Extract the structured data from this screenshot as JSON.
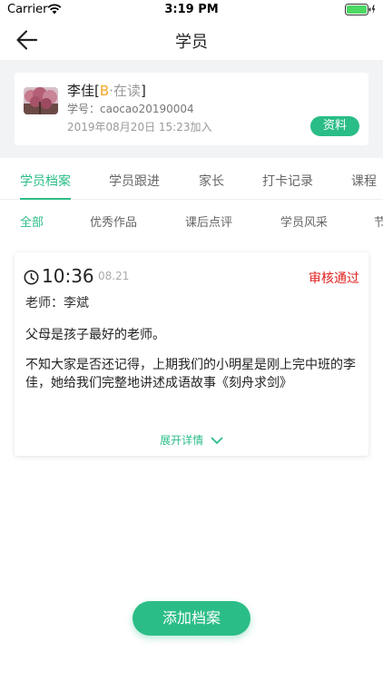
{
  "status_bar": {
    "carrier": "Carrier",
    "time": "3:19 PM"
  },
  "nav": {
    "title": "学员"
  },
  "student": {
    "name": "李佳",
    "bracket_open": "[",
    "level": "B",
    "status": "·在读",
    "bracket_close": "]",
    "id_line": "学号：caocao20190004",
    "join_date": "2019年08月20日 15:23加入",
    "profile_button": "资料"
  },
  "main_tabs": [
    {
      "label": "学员档案",
      "active": true
    },
    {
      "label": "学员跟进"
    },
    {
      "label": "家长"
    },
    {
      "label": "打卡记录"
    },
    {
      "label": "课程"
    }
  ],
  "sub_tabs": [
    {
      "label": "全部",
      "active": true
    },
    {
      "label": "优秀作品"
    },
    {
      "label": "课后点评"
    },
    {
      "label": "学员风采"
    },
    {
      "label": "节"
    }
  ],
  "record": {
    "time": "10:36",
    "date": "08.21",
    "review_status": "审核通过",
    "teacher": "老师：李斌",
    "text_1": "父母是孩子最好的老师。",
    "text_2": "不知大家是否还记得，上期我们的小明星是刚上完中班的李佳，她给我们完整地讲述成语故事《刻舟求剑》",
    "expand_label": "展开详情"
  },
  "add_button": "添加档案",
  "colors": {
    "accent": "#2bbd87",
    "approved": "#e02020",
    "level": "#f5a623"
  }
}
